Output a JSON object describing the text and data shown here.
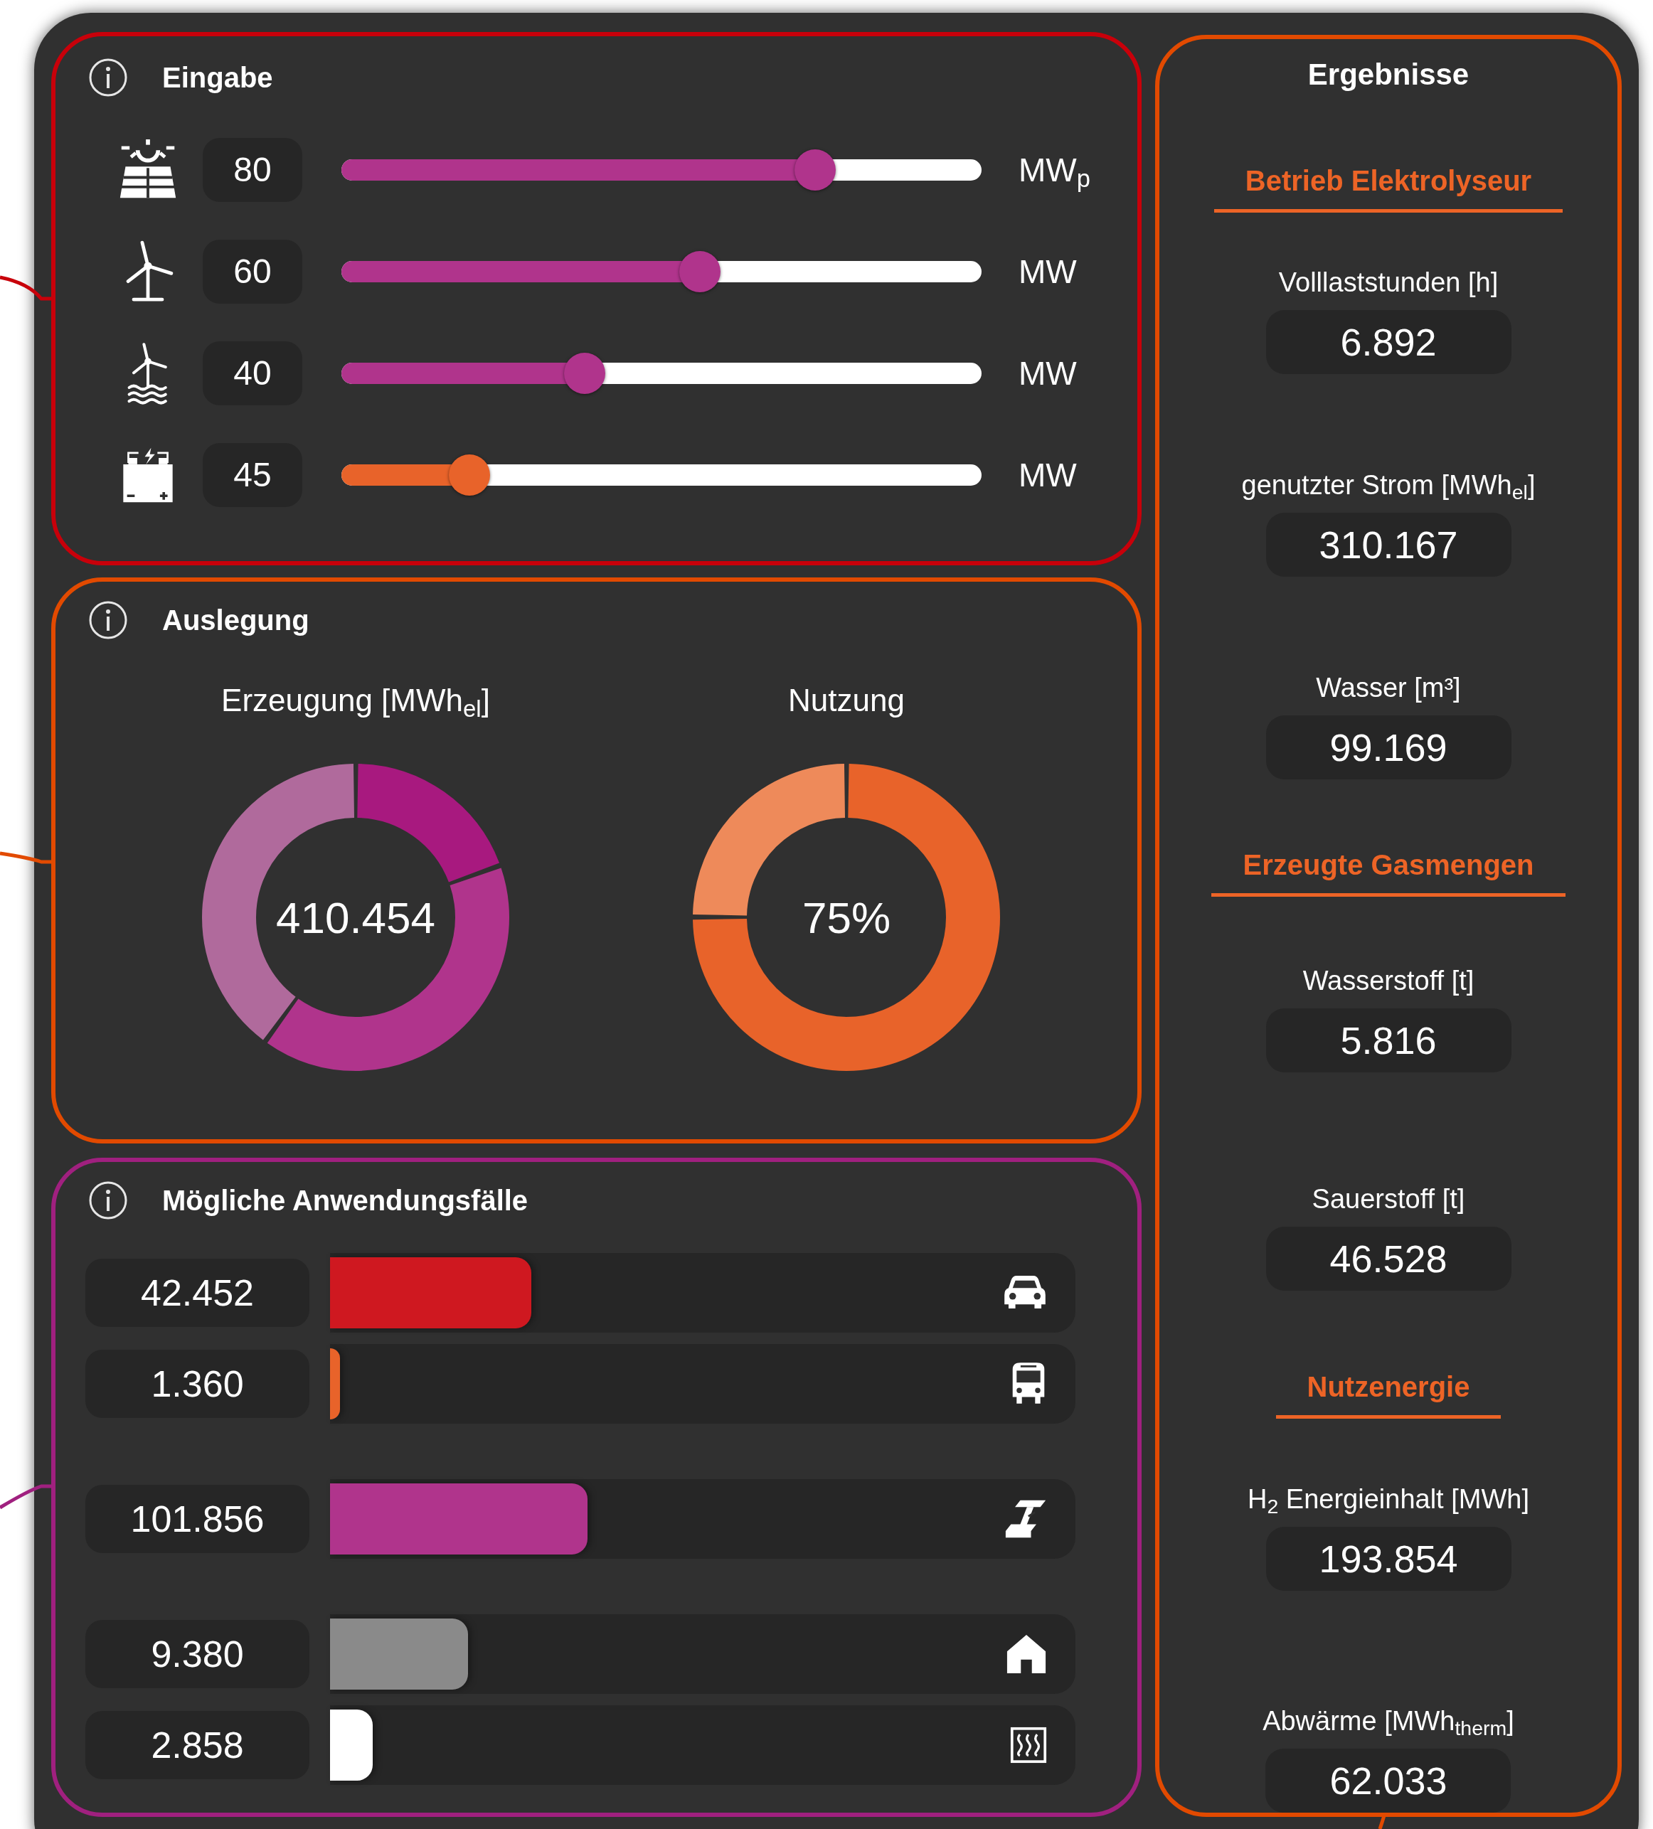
{
  "input_panel": {
    "title": "Eingabe",
    "sliders": [
      {
        "value": "80",
        "unit": "MW$_{p}$",
        "level": 0.74,
        "color": "#b0348c"
      },
      {
        "value": "60",
        "unit": "MW",
        "level": 0.56,
        "color": "#b0348c"
      },
      {
        "value": "40",
        "unit": "MW",
        "level": 0.38,
        "color": "#b0348c"
      },
      {
        "value": "45",
        "unit": "MW",
        "level": 0.2,
        "color": "#e8632a"
      }
    ]
  },
  "design_panel": {
    "title": "Auslegung",
    "donuts": [
      {
        "label": "Erzeugung [MWh$_{el}$]",
        "center": "410.454"
      },
      {
        "label": "Nutzung",
        "center": "75%"
      }
    ]
  },
  "use_cases_panel": {
    "title": "Mögliche Anwendungsfälle",
    "groups": [
      {
        "rows": [
          {
            "value": "42.452",
            "level": 0.27,
            "color": "#cf1820"
          },
          {
            "value": "1.360",
            "level": 0.013,
            "color": "#e8632a"
          }
        ]
      },
      {
        "rows": [
          {
            "value": "101.856",
            "level": 0.345,
            "color": "#b0348c"
          }
        ]
      },
      {
        "rows": [
          {
            "value": "9.380",
            "level": 0.185,
            "color": "#8a8a8a"
          },
          {
            "value": "2.858",
            "level": 0.057,
            "color": "#ffffff"
          }
        ]
      }
    ]
  },
  "results_panel": {
    "title": "Ergebnisse",
    "sections": [
      {
        "heading": "Betrieb Elektrolyseur",
        "items": [
          {
            "label": "Volllaststunden [h]",
            "value": "6.892"
          },
          {
            "label": "genutzter Strom [MWh$_{el}$]",
            "value": "310.167"
          },
          {
            "label": "Wasser [m³]",
            "value": "99.169"
          }
        ]
      },
      {
        "heading": "Erzeugte Gasmengen",
        "items": [
          {
            "label": "Wasserstoff [t]",
            "value": "5.816"
          },
          {
            "label": "Sauerstoff [t]",
            "value": "46.528"
          }
        ]
      },
      {
        "heading": "Nutzenergie",
        "items": [
          {
            "label": "H$_{2}$ Energieinhalt [MWh]",
            "value": "193.854"
          },
          {
            "label": "Abwärme [MWh$_{therm}$]",
            "value": "62.033"
          }
        ]
      }
    ]
  }
}
